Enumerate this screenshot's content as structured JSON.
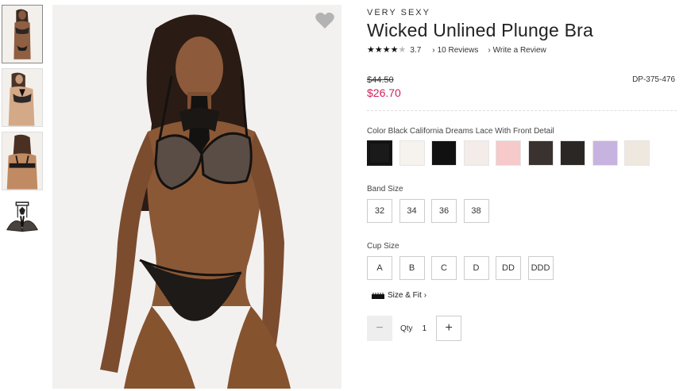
{
  "product": {
    "brand": "VERY SEXY",
    "title": "Wicked Unlined Plunge Bra",
    "rating_value": "3.7",
    "rating_stars": 3.7,
    "reviews_link": "10 Reviews",
    "write_review_link": "Write a Review",
    "price_original": "$44.50",
    "price_sale": "$26.70",
    "sku": "DP-375-476"
  },
  "color": {
    "label": "Color Black California Dreams Lace With Front Detail",
    "swatches": [
      {
        "color": "#1a1a1a",
        "selected": true
      },
      {
        "color": "#f6f3ee",
        "selected": false
      },
      {
        "color": "#111111",
        "selected": false
      },
      {
        "color": "#f3ece8",
        "selected": false
      },
      {
        "color": "#f6c9cb",
        "selected": false
      },
      {
        "color": "#3a322e",
        "selected": false
      },
      {
        "color": "#2b2724",
        "selected": false
      },
      {
        "color": "#c7b3e0",
        "selected": false
      },
      {
        "color": "#efe8df",
        "selected": false
      }
    ]
  },
  "band_size": {
    "label": "Band Size",
    "options": [
      "32",
      "34",
      "36",
      "38"
    ]
  },
  "cup_size": {
    "label": "Cup Size",
    "options": [
      "A",
      "B",
      "C",
      "D",
      "DD",
      "DDD"
    ]
  },
  "fit": {
    "label": "Size & Fit",
    "chevron": "›"
  },
  "quantity": {
    "minus": "−",
    "label": "Qty",
    "value": "1",
    "plus": "+"
  },
  "icons": {
    "favorite": "heart-icon",
    "ruler": "ruler-icon"
  },
  "colors": {
    "sale_price": "#d1205a"
  }
}
